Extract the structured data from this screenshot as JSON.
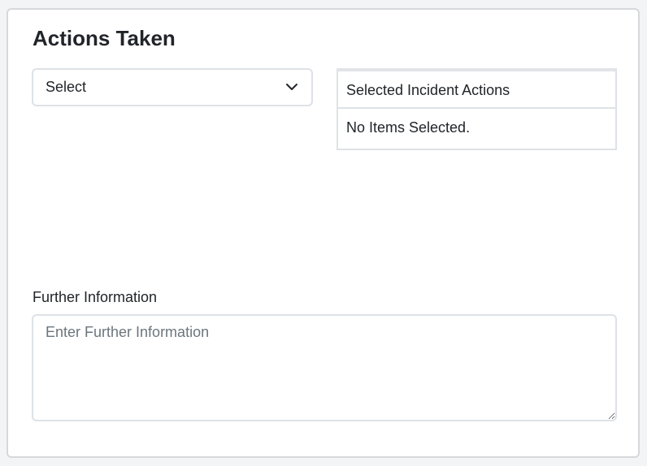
{
  "section": {
    "title": "Actions Taken"
  },
  "select": {
    "value": "Select",
    "icon": "chevron-down-icon"
  },
  "selected_panel": {
    "header": "Selected Incident Actions",
    "empty_text": "No Items Selected."
  },
  "further_information": {
    "label": "Further Information",
    "placeholder": "Enter Further Information",
    "value": ""
  }
}
